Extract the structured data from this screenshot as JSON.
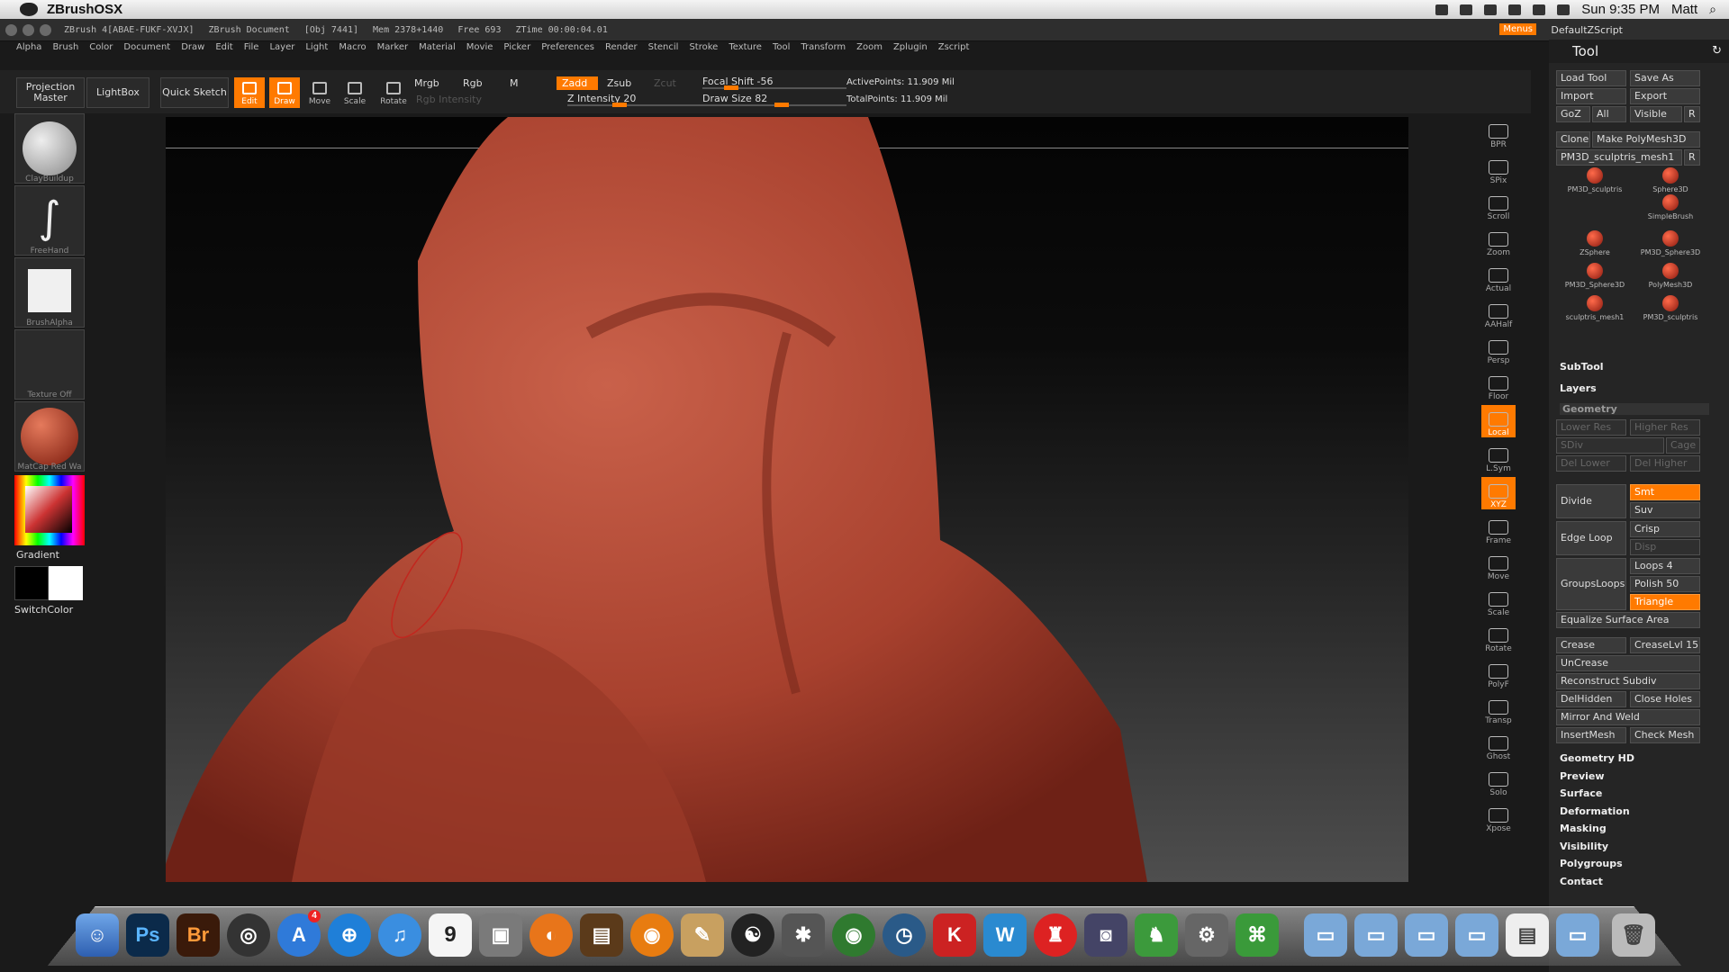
{
  "os_menubar": {
    "app_name": "ZBrushOSX",
    "clock": "Sun 9:35 PM",
    "user": "Matt"
  },
  "title_bar": {
    "version": "ZBrush 4[ABAE-FUKF-XVJX]",
    "doc": "ZBrush Document",
    "obj": "[Obj 7441]",
    "mem": "Mem 2378+1440",
    "free": "Free 693",
    "ztime": "ZTime 00:00:04.01",
    "menus_badge": "Menus",
    "default_script": "DefaultZScript"
  },
  "menu": [
    "Alpha",
    "Brush",
    "Color",
    "Document",
    "Draw",
    "Edit",
    "File",
    "Layer",
    "Light",
    "Macro",
    "Marker",
    "Material",
    "Movie",
    "Picker",
    "Preferences",
    "Render",
    "Stencil",
    "Stroke",
    "Texture",
    "Tool",
    "Transform",
    "Zoom",
    "Zplugin",
    "Zscript"
  ],
  "shelf": {
    "projection_master": "Projection Master",
    "lightbox": "LightBox",
    "quick_sketch": "Quick Sketch",
    "edit": "Edit",
    "draw": "Draw",
    "move": "Move",
    "scale": "Scale",
    "rotate": "Rotate",
    "mrgb": "Mrgb",
    "rgb": "Rgb",
    "m": "M",
    "rgb_intensity": "Rgb Intensity",
    "zadd": "Zadd",
    "zsub": "Zsub",
    "zcut": "Zcut",
    "z_intensity": "Z Intensity 20",
    "focal_shift": "Focal Shift -56",
    "draw_size": "Draw Size 82",
    "active_points": "ActivePoints: 11.909 Mil",
    "total_points": "TotalPoints: 11.909 Mil"
  },
  "left_panel": {
    "brush": "ClayBuildup",
    "stroke": "FreeHand",
    "alpha": "BrushAlpha",
    "texture": "Texture Off",
    "material": "MatCap Red Wa",
    "gradient": "Gradient",
    "switch_color": "SwitchColor"
  },
  "right_tools": [
    "BPR",
    "SPix",
    "Scroll",
    "Zoom",
    "Actual",
    "AAHalf",
    "Persp",
    "Floor",
    "Local",
    "L.Sym",
    "XYZ",
    "Frame",
    "Move",
    "Scale",
    "Rotate",
    "PolyF",
    "Transp",
    "Ghost",
    "Solo",
    "Xpose"
  ],
  "tool_panel": {
    "title": "Tool",
    "load_tool": "Load Tool",
    "save_as": "Save As",
    "import": "Import",
    "export": "Export",
    "goz": "GoZ",
    "all": "All",
    "visible": "Visible",
    "r": "R",
    "clone": "Clone",
    "make_polymesh": "Make PolyMesh3D",
    "current_tool": "PM3D_sculptris_mesh1",
    "meshes": [
      "PM3D_sculptris",
      "Sphere3D",
      "SimpleBrush",
      "ZSphere",
      "PM3D_Sphere3D",
      "PM3D_Sphere3D",
      "PolyMesh3D",
      "sculptris_mesh1",
      "PM3D_sculptris"
    ],
    "subtool": "SubTool",
    "layers": "Layers",
    "geometry": "Geometry",
    "lower_res": "Lower Res",
    "higher_res": "Higher Res",
    "sdiv": "SDiv",
    "cage": "Cage",
    "del_lower": "Del Lower",
    "del_higher": "Del Higher",
    "divide": "Divide",
    "smt": "Smt",
    "suv": "Suv",
    "edge_loop": "Edge Loop",
    "crisp": "Crisp",
    "disp": "Disp",
    "groups_loops": "GroupsLoops",
    "loops": "Loops 4",
    "polish": "Polish 50",
    "triangle": "Triangle",
    "equalize": "Equalize Surface Area",
    "crease": "Crease",
    "crease_lvl": "CreaseLvl 15",
    "uncrease": "UnCrease",
    "reconstruct": "Reconstruct Subdiv",
    "delhidden": "DelHidden",
    "close_holes": "Close Holes",
    "mirror_weld": "Mirror And Weld",
    "insertmesh": "InsertMesh",
    "check_mesh": "Check Mesh",
    "sections": [
      "Geometry HD",
      "Preview",
      "Surface",
      "Deformation",
      "Masking",
      "Visibility",
      "Polygroups",
      "Contact"
    ]
  },
  "dock": {
    "photoshop": "Ps",
    "bridge": "Br",
    "appstore_badge": "4",
    "ical_day": "9"
  }
}
